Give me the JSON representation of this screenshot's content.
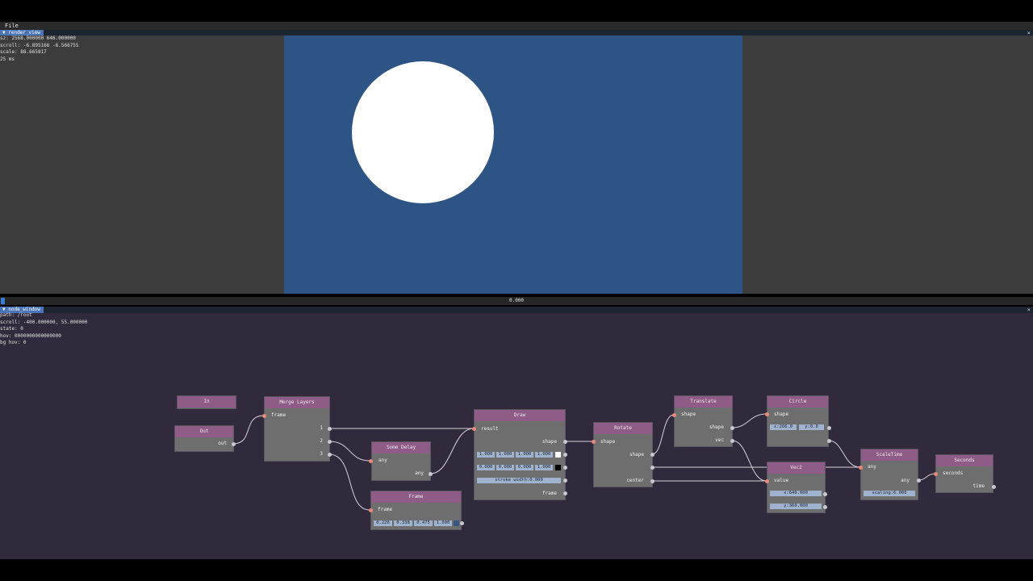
{
  "menu": {
    "file_label": "File"
  },
  "render_view": {
    "tab_label": "render_view",
    "close": "×",
    "info": [
      "sz: 2568.000000 646.000000",
      "scroll: -6.895166 -6.566755",
      "scale: 88.665817",
      "25 ms"
    ]
  },
  "timeline": {
    "time": "0.000",
    "progress": 0.0
  },
  "node_window": {
    "tab_label": "node_window",
    "close": "×",
    "info": [
      "path: /root",
      "scroll: -400.000000, 55.000000",
      "state: 0",
      "hov: 0000000000000000",
      "bg hov: 0"
    ]
  },
  "colors": {
    "canvas_bg": "#2e5486",
    "node_header": "#8e5c86",
    "node_body": "#6e6e6e",
    "input_pin": "#e88a7a",
    "output_pin": "#c8c8d0",
    "field_bg": "#9fb3cf",
    "graph_bg": "#302a3c"
  },
  "nodes": {
    "in": {
      "title": "In"
    },
    "out": {
      "title": "Out",
      "outputs": [
        "out"
      ]
    },
    "merge_layers": {
      "title": "Merge Layers",
      "inputs": [
        "frame"
      ],
      "outputs": [
        "1",
        "2",
        "3"
      ]
    },
    "some_delay": {
      "title": "Some Delay",
      "inputs": [
        "any"
      ],
      "outputs": [
        "any"
      ]
    },
    "frame": {
      "title": "Frame",
      "inputs": [
        "frame"
      ],
      "fields": [
        "0.226",
        "0.338",
        "0.475",
        "1.000"
      ]
    },
    "draw": {
      "title": "Draw",
      "inputs": [
        "result"
      ],
      "outputs": [
        "shape",
        "frame"
      ],
      "fill": [
        "1.000",
        "1.000",
        "1.000",
        "1.000"
      ],
      "stroke": [
        "0.000",
        "0.000",
        "0.000",
        "1.000"
      ],
      "stroke_width": "stroke width:0.000"
    },
    "rotate": {
      "title": "Rotate",
      "inputs": [
        "shape"
      ],
      "outputs": [
        "shape",
        "center"
      ]
    },
    "translate": {
      "title": "Translate",
      "inputs": [
        "shape"
      ],
      "outputs": [
        "shape",
        "vec"
      ]
    },
    "circle": {
      "title": "Circle",
      "inputs": [
        "shape"
      ],
      "fields": [
        "x:266.0",
        "y:0.0"
      ]
    },
    "vec2": {
      "title": "Vec2",
      "inputs": [
        "value"
      ],
      "fields": [
        "x:640.000",
        "y:360.000"
      ]
    },
    "scale_time": {
      "title": "ScaleTime",
      "inputs": [
        "any"
      ],
      "outputs": [
        "any"
      ],
      "field": "scaling:6.000"
    },
    "seconds": {
      "title": "Seconds",
      "inputs": [
        "seconds"
      ],
      "outputs": [
        "time"
      ]
    }
  }
}
